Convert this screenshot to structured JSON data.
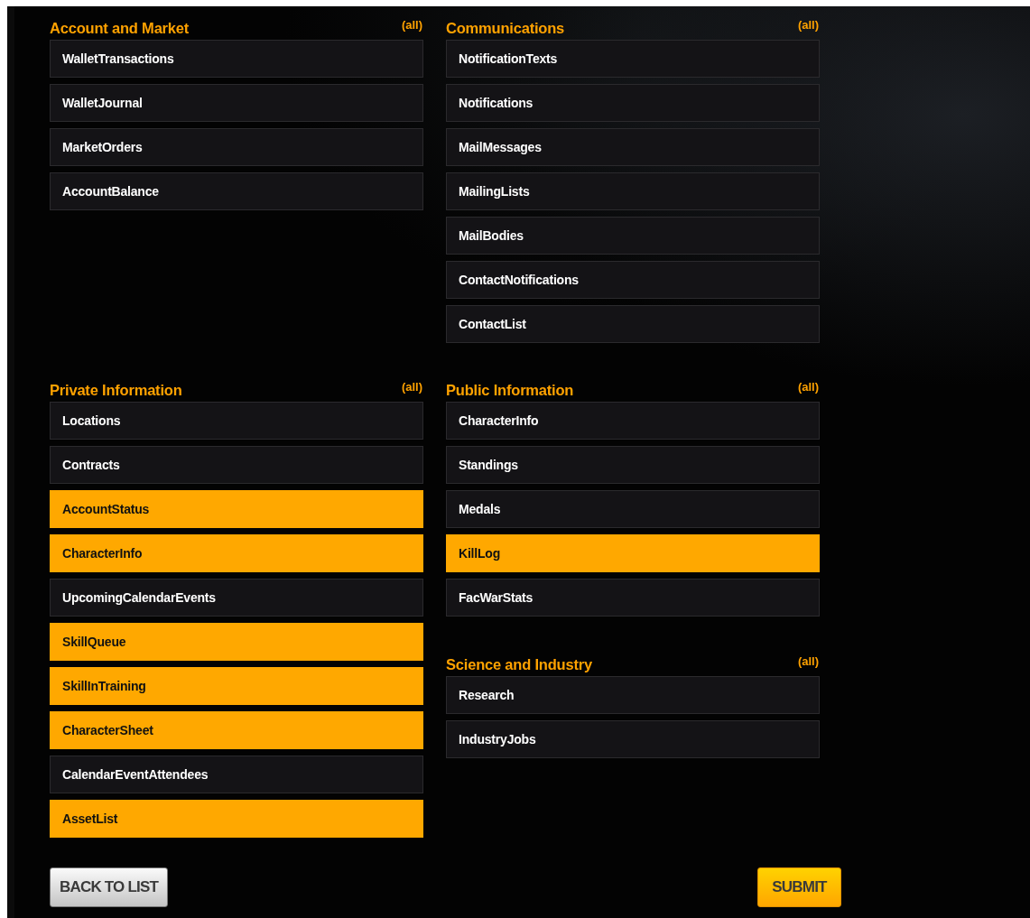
{
  "rows": [
    {
      "columns": [
        {
          "sections": [
            {
              "title": "Account and Market",
              "all_link": "(all)",
              "items": [
                {
                  "label": "WalletTransactions",
                  "selected": false
                },
                {
                  "label": "WalletJournal",
                  "selected": false
                },
                {
                  "label": "MarketOrders",
                  "selected": false
                },
                {
                  "label": "AccountBalance",
                  "selected": false
                }
              ]
            }
          ]
        },
        {
          "sections": [
            {
              "title": "Communications",
              "all_link": "(all)",
              "items": [
                {
                  "label": "NotificationTexts",
                  "selected": false
                },
                {
                  "label": "Notifications",
                  "selected": false
                },
                {
                  "label": "MailMessages",
                  "selected": false
                },
                {
                  "label": "MailingLists",
                  "selected": false
                },
                {
                  "label": "MailBodies",
                  "selected": false
                },
                {
                  "label": "ContactNotifications",
                  "selected": false
                },
                {
                  "label": "ContactList",
                  "selected": false
                }
              ]
            }
          ]
        }
      ]
    },
    {
      "columns": [
        {
          "sections": [
            {
              "title": "Private Information",
              "all_link": "(all)",
              "items": [
                {
                  "label": "Locations",
                  "selected": false
                },
                {
                  "label": "Contracts",
                  "selected": false
                },
                {
                  "label": "AccountStatus",
                  "selected": true
                },
                {
                  "label": "CharacterInfo",
                  "selected": true
                },
                {
                  "label": "UpcomingCalendarEvents",
                  "selected": false
                },
                {
                  "label": "SkillQueue",
                  "selected": true
                },
                {
                  "label": "SkillInTraining",
                  "selected": true
                },
                {
                  "label": "CharacterSheet",
                  "selected": true
                },
                {
                  "label": "CalendarEventAttendees",
                  "selected": false
                },
                {
                  "label": "AssetList",
                  "selected": true
                }
              ]
            }
          ]
        },
        {
          "sections": [
            {
              "title": "Public Information",
              "all_link": "(all)",
              "items": [
                {
                  "label": "CharacterInfo",
                  "selected": false
                },
                {
                  "label": "Standings",
                  "selected": false
                },
                {
                  "label": "Medals",
                  "selected": false
                },
                {
                  "label": "KillLog",
                  "selected": true
                },
                {
                  "label": "FacWarStats",
                  "selected": false
                }
              ]
            },
            {
              "title": "Science and Industry",
              "all_link": "(all)",
              "items": [
                {
                  "label": "Research",
                  "selected": false
                },
                {
                  "label": "IndustryJobs",
                  "selected": false
                }
              ]
            }
          ]
        }
      ]
    }
  ],
  "buttons": {
    "back": "BACK TO LIST",
    "submit": "SUBMIT"
  }
}
